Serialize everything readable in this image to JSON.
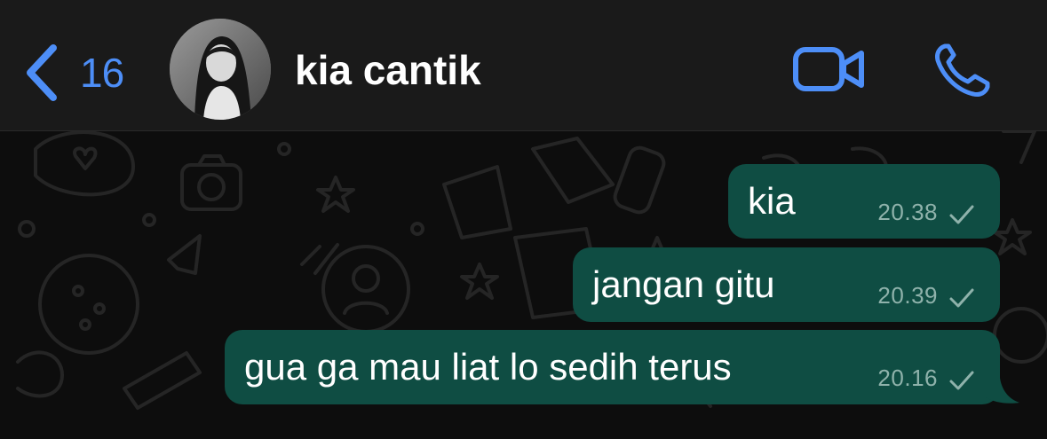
{
  "header": {
    "back_count": "16",
    "contact_name": "kia cantik"
  },
  "messages": [
    {
      "text": "kia",
      "time": "20.38",
      "status": "sent"
    },
    {
      "text": "jangan gitu",
      "time": "20.39",
      "status": "sent"
    },
    {
      "text": "gua ga mau liat lo sedih terus",
      "time": "20.16",
      "status": "sent"
    }
  ],
  "colors": {
    "accent": "#4d8ef7",
    "outgoing_bubble": "#0f4d43",
    "header_bg": "#1a1a1a",
    "chat_bg": "#0d0d0d",
    "timestamp": "#8fb2ab"
  },
  "icons": {
    "back": "chevron-left-icon",
    "video": "video-camera-icon",
    "voice": "phone-icon",
    "status": "single-check-icon"
  }
}
